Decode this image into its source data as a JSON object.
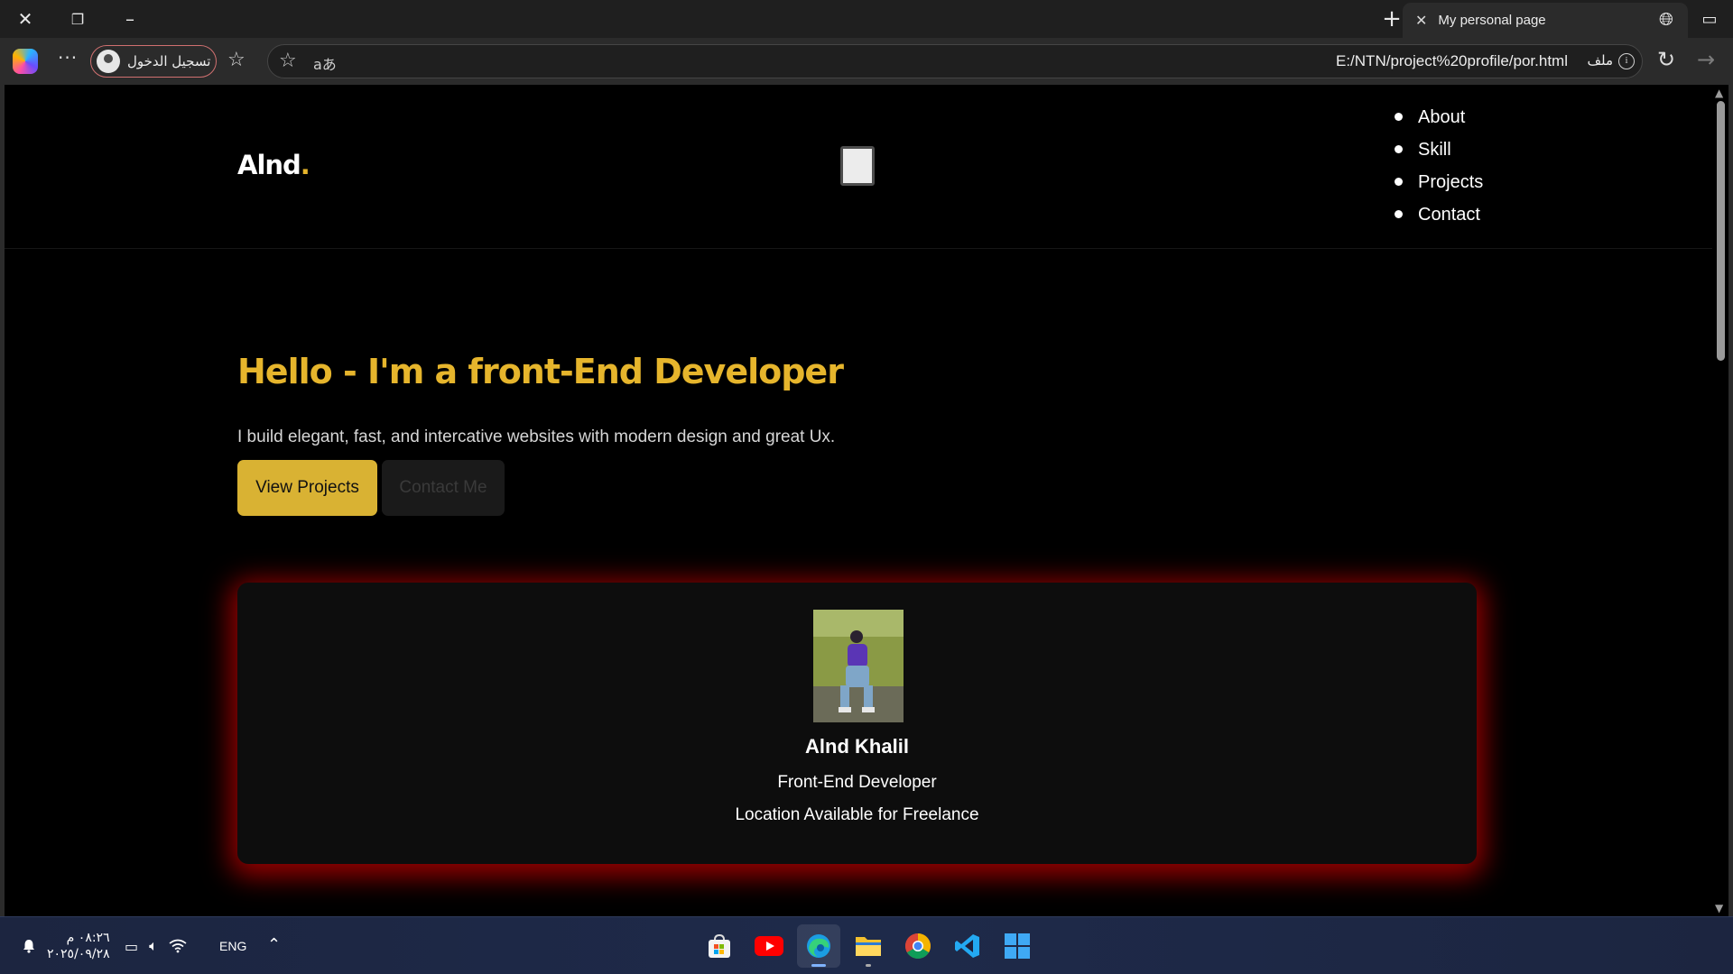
{
  "browser": {
    "tab_title": "My personal page",
    "signin_label": "تسجيل الدخول",
    "url": "E:/NTN/project%20profile/por.html",
    "url_scheme_label": "ملف"
  },
  "site": {
    "logo_text": "Alnd",
    "logo_dot": ".",
    "nav": [
      "About",
      "Skill",
      "Projects",
      "Contact"
    ],
    "hero_title": "Hello - I'm a front-End Developer",
    "hero_subtitle": "I build elegant, fast, and intercative websites with modern design and great Ux.",
    "btn_primary": "View Projects",
    "btn_secondary": "Contact Me",
    "card": {
      "name": "Alnd Khalil",
      "role": "Front-End Developer",
      "location": "Location Available for Freelance"
    },
    "colors": {
      "accent": "#e6b52c",
      "card_glow": "#c80000"
    }
  },
  "taskbar": {
    "time": "٠٨:٢٦ م",
    "date": "٢٠٢٥/٠٩/٢٨",
    "language": "ENG",
    "apps": [
      "store-icon",
      "youtube-icon",
      "edge-icon",
      "file-explorer-icon",
      "chrome-icon",
      "vscode-icon",
      "windows-icon"
    ]
  }
}
